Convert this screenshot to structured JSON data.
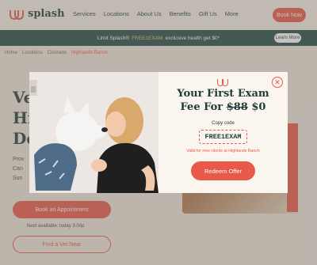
{
  "header": {
    "brand": "splash",
    "menu": [
      "Services",
      "Locations",
      "About Us",
      "Benefits",
      "Gift Us",
      "More"
    ],
    "cta_label": "Book Now"
  },
  "promo_bar": {
    "text_before": "Limit Splash®",
    "code_text": "FREE1EXAM",
    "text_after": "exclusive health get $0*",
    "button_label": "Learn More"
  },
  "breadcrumb": [
    "Home",
    "Locations",
    "Colorado",
    "Highlands Ranch"
  ],
  "background_page": {
    "heading_lines": [
      "Ve",
      "Hi",
      "De"
    ],
    "side_text_lines": [
      "Prov",
      "Can",
      "Sun"
    ],
    "book_button": "Book an Appointment",
    "small_text": "Next available: today 3:00p",
    "outline_button": "Find a Vet Near"
  },
  "modal": {
    "headline_line1": "Your First Exam",
    "headline_fee_label": "Fee For",
    "old_price": "$88",
    "new_price": "$0",
    "copy_label": "Copy code",
    "code": "FREE1EXAM",
    "valid_text": "Valid for new clients at Highlands Ranch",
    "redeem_label": "Redeem Offer",
    "close_symbol": "✕"
  },
  "colors": {
    "accent": "#e8594a",
    "dark_teal": "#1f4a47",
    "cream": "#fbf5ef"
  }
}
